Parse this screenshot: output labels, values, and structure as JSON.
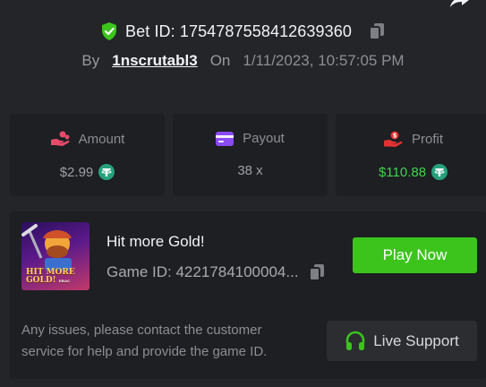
{
  "bet": {
    "id_label": "Bet ID: 1754787558412639360",
    "by_label": "By",
    "author": "1nscrutabl3",
    "on_label": "On",
    "date": "1/11/2023, 10:57:05 PM"
  },
  "stats": [
    {
      "label": "Amount",
      "value": "$2.99",
      "icon": "hand-coins-icon",
      "value_color": "#9ea0a5"
    },
    {
      "label": "Payout",
      "value": "38 x",
      "icon": "wallet-card-icon",
      "value_color": "#9ea0a5"
    },
    {
      "label": "Profit",
      "value": "$110.88",
      "icon": "hand-money-icon",
      "value_color": "#3fd44c"
    }
  ],
  "currency_icon": "tether-icon",
  "game": {
    "title": "Hit more Gold!",
    "id_label": "Game ID: 4221784100004...",
    "thumb_text_line1": "HIT MORE",
    "thumb_text_line2": "GOLD!",
    "thumb_text_small": "ERAC",
    "play_label": "Play Now"
  },
  "support": {
    "help_text": "Any issues, please contact the customer service for help and provide the game ID.",
    "button_label": "Live Support"
  },
  "colors": {
    "accent_green": "#3cc41d",
    "background": "#232528",
    "card": "#1d1f22",
    "tether": "#26a17b"
  }
}
